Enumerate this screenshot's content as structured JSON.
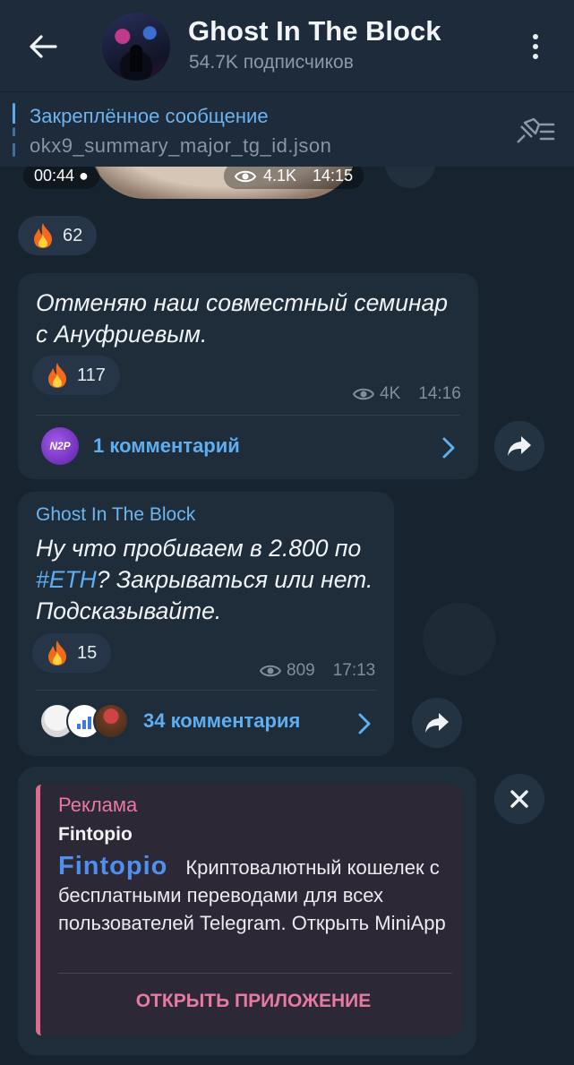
{
  "header": {
    "title": "Ghost In The Block",
    "subscribers": "54.7K подписчиков"
  },
  "pinned": {
    "title": "Закреплённое сообщение",
    "text": "okx9_summary_major_tg_id.json"
  },
  "video_message": {
    "duration": "00:44",
    "views": "4.1K",
    "time": "14:15",
    "reaction_count": "62"
  },
  "message1": {
    "text": "Отменяю наш совместный семинар с Ануфриевым.",
    "reaction_count": "117",
    "views": "4K",
    "time": "14:16",
    "comments_label": "1 комментарий",
    "commenter_avatar_text": "N2P"
  },
  "message2": {
    "author": "Ghost In The Block",
    "text_before": "Ну что пробиваем в 2.800 по ",
    "hashtag": "#ETH",
    "text_after": "? Закрываться или нет. Подсказывайте.",
    "reaction_count": "15",
    "views": "809",
    "time": "17:13",
    "comments_label": "34 комментария"
  },
  "ad": {
    "label": "Реклама",
    "name": "Fintopio",
    "logo_text": "Fintopio",
    "body": "Криптовалютный кошелек с бесплатными переводами для всех пользователей Telegram. Открыть MiniApp",
    "cta": "ОТКРЫТЬ ПРИЛОЖЕНИЕ"
  },
  "colors": {
    "accent": "#5eaef0",
    "ad_accent": "#e87aa0",
    "bubble": "#1f2c3a",
    "header": "#1d2b3a"
  },
  "icons": {
    "back": "arrow-left-icon",
    "menu": "more-vertical-icon",
    "pin_list": "pin-list-icon",
    "views": "eye-icon",
    "reaction": "fire-icon",
    "share": "share-icon",
    "close": "close-icon"
  }
}
